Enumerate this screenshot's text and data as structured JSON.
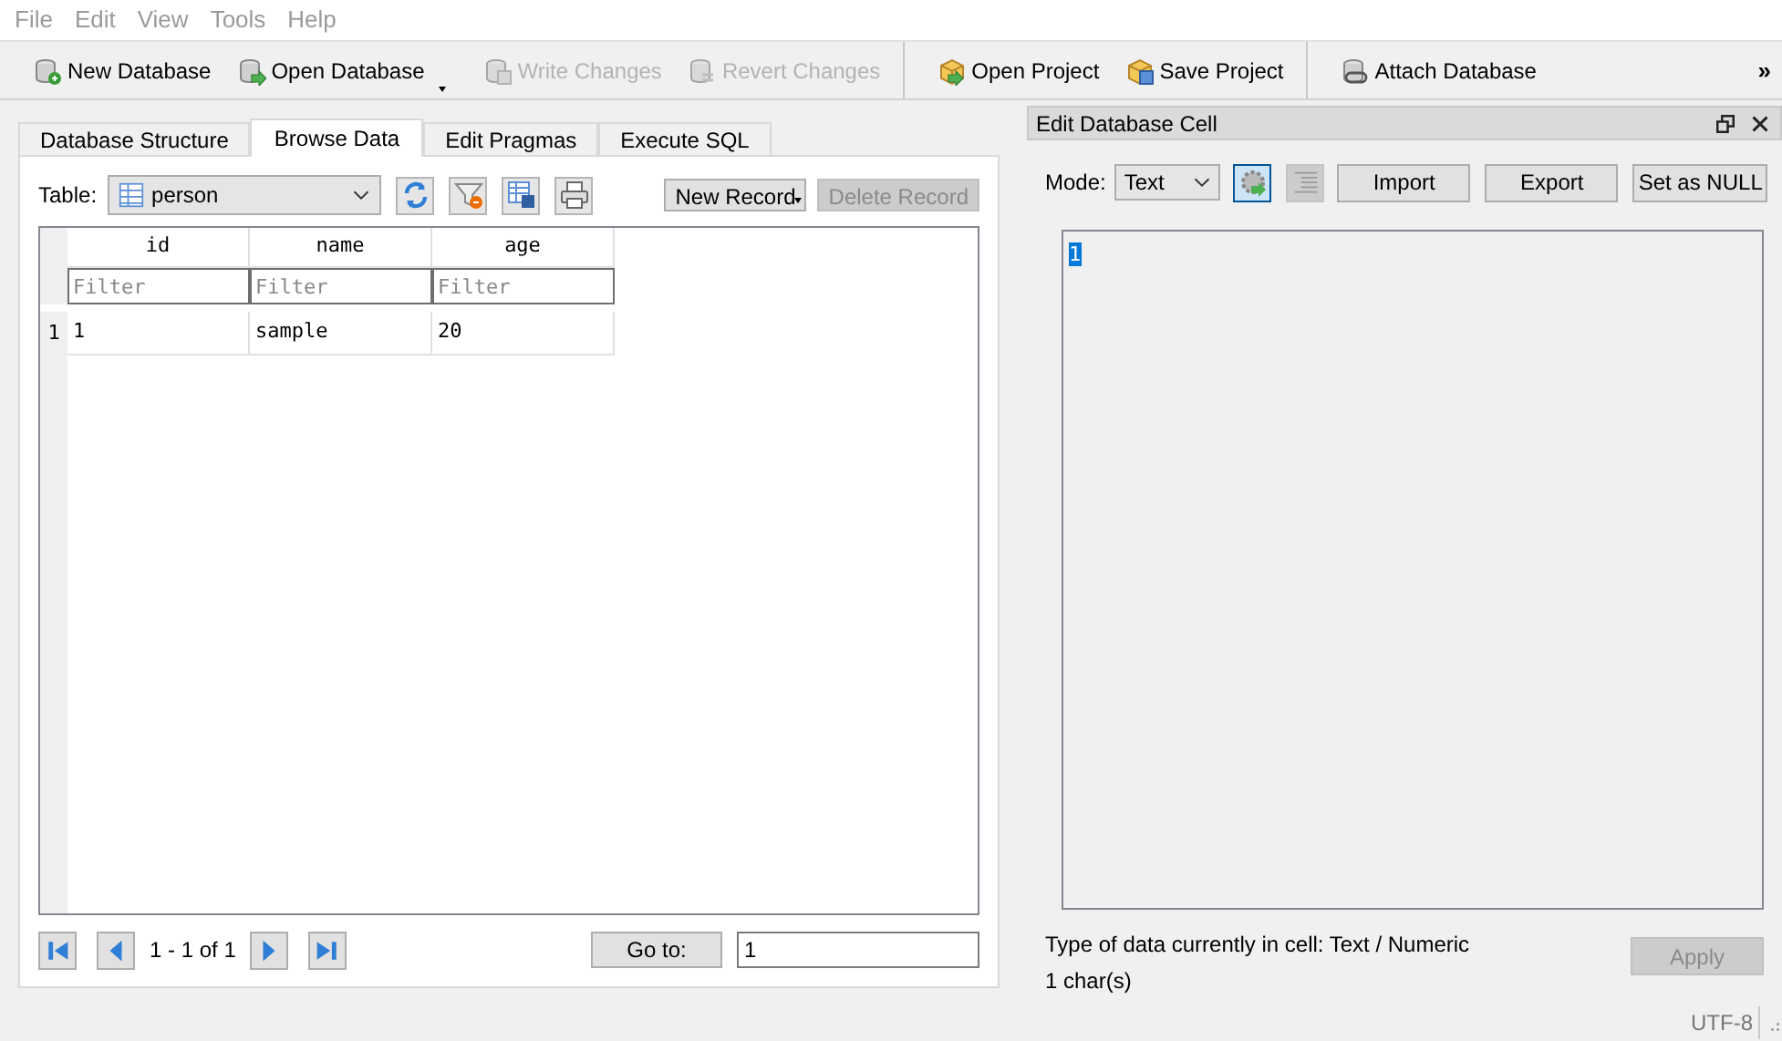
{
  "menu": [
    "File",
    "Edit",
    "View",
    "Tools",
    "Help"
  ],
  "toolbar": {
    "groups": [
      [
        {
          "label": "New Database",
          "disabled": false,
          "dropdown": false
        },
        {
          "label": "Open Database",
          "disabled": false,
          "dropdown": true
        }
      ],
      [
        {
          "label": "Write Changes",
          "disabled": true,
          "dropdown": false
        },
        {
          "label": "Revert Changes",
          "disabled": true,
          "dropdown": false
        }
      ],
      [
        {
          "label": "Open Project",
          "disabled": false,
          "dropdown": false
        },
        {
          "label": "Save Project",
          "disabled": false,
          "dropdown": false
        }
      ],
      [
        {
          "label": "Attach Database",
          "disabled": false,
          "dropdown": false
        }
      ]
    ],
    "overflow": "»"
  },
  "tabs": [
    {
      "label": "Database Structure",
      "selected": false
    },
    {
      "label": "Browse Data",
      "selected": true
    },
    {
      "label": "Edit Pragmas",
      "selected": false
    },
    {
      "label": "Execute SQL",
      "selected": false
    }
  ],
  "table_selector": {
    "label": "Table:",
    "value": "person"
  },
  "record_buttons": [
    {
      "label": "New Record",
      "disabled": false,
      "dropdown": true
    },
    {
      "label": "Delete Record",
      "disabled": true,
      "dropdown": false
    }
  ],
  "grid": {
    "columns": [
      {
        "name": "id",
        "filter_placeholder": "Filter"
      },
      {
        "name": "name",
        "filter_placeholder": "Filter"
      },
      {
        "name": "age",
        "filter_placeholder": "Filter"
      }
    ],
    "rows": [
      {
        "number": "1",
        "cells": [
          "1",
          "sample",
          "20"
        ]
      }
    ]
  },
  "pager": {
    "position": "1 - 1 of 1",
    "goto_button": "Go to:",
    "goto_value": "1"
  },
  "dock": {
    "title": "Edit Database Cell",
    "mode_label": "Mode:",
    "mode_value": "Text",
    "auto_switch_on": true,
    "word_wrap_on": false,
    "buttons": [
      "Import",
      "Export",
      "Set as NULL"
    ],
    "editor_text": "1",
    "editor_text_selected": true,
    "type_info": "Type of data currently in cell: Text / Numeric",
    "char_count": "1 char(s)",
    "apply": {
      "label": "Apply",
      "disabled": true
    }
  },
  "status": {
    "encoding": "UTF-8"
  }
}
